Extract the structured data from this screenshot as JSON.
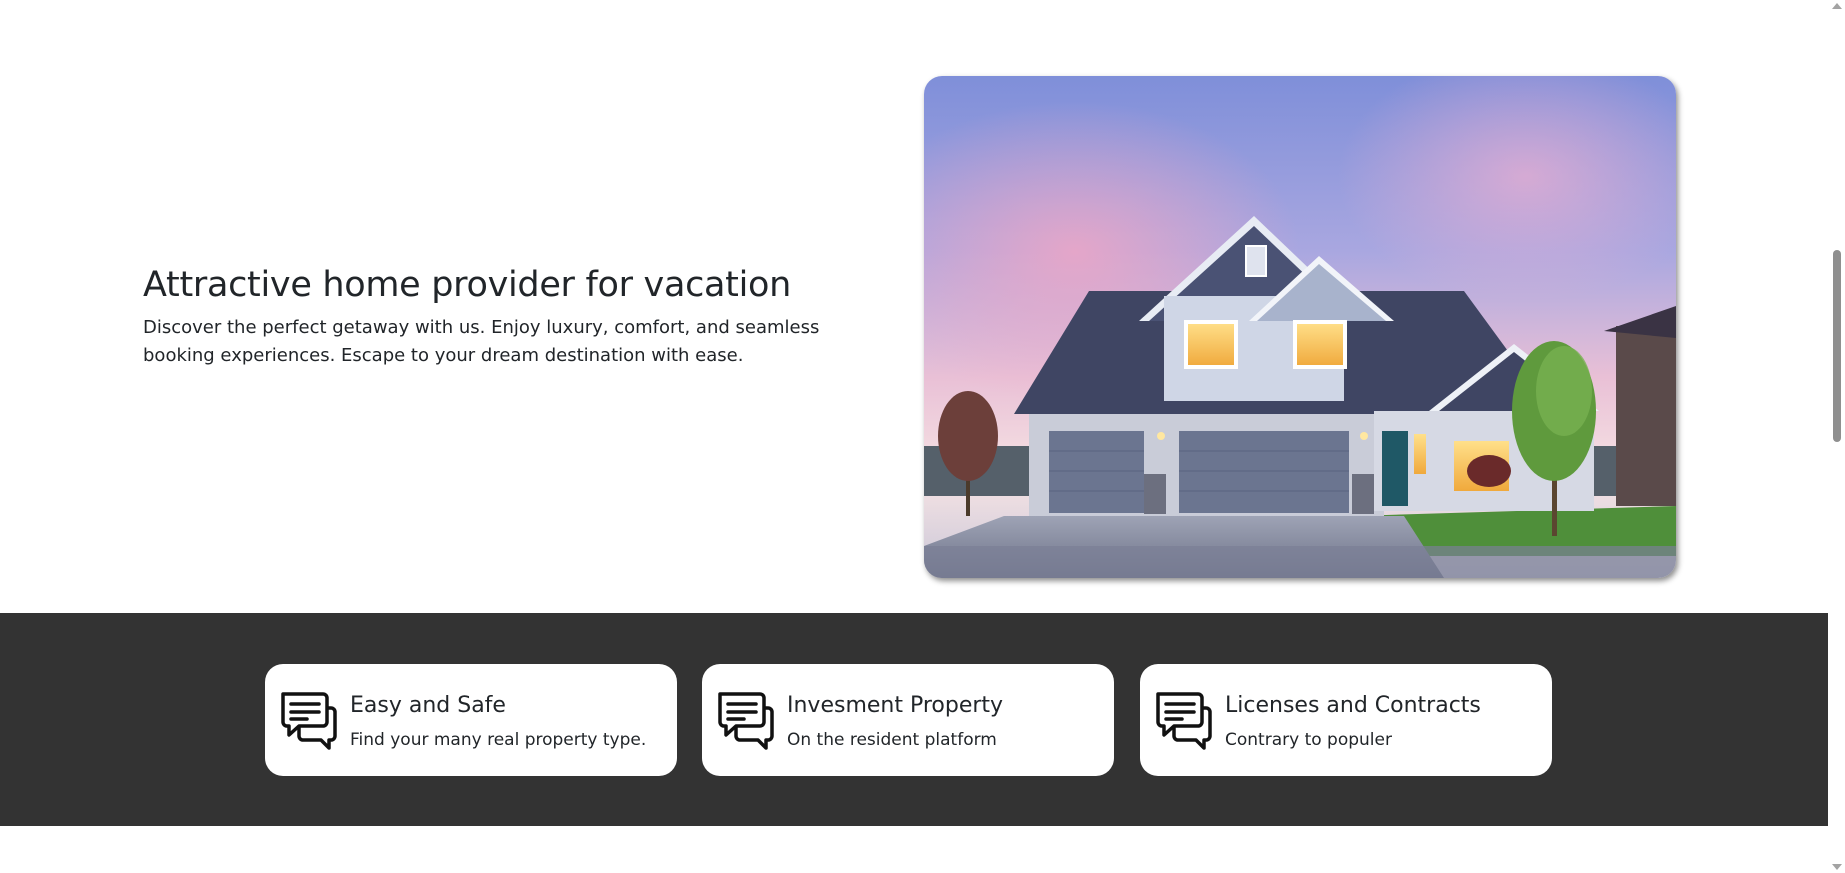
{
  "hero": {
    "title": "Attractive home provider for vacation",
    "description": "Discover the perfect getaway with us. Enjoy luxury, comfort, and seamless booking experiences. Escape to your dream destination with ease."
  },
  "features": {
    "band_color": "#333333",
    "items": [
      {
        "icon": "chat-bubbles-icon",
        "title": "Easy and Safe",
        "subtitle": "Find your many real property type."
      },
      {
        "icon": "chat-bubbles-icon",
        "title": "Invesment Property",
        "subtitle": "On the resident platform"
      },
      {
        "icon": "chat-bubbles-icon",
        "title": "Licenses and Contracts",
        "subtitle": "Contrary to populer"
      }
    ]
  },
  "scrollbar": {
    "up_icon": "scroll-up-arrow-icon",
    "down_icon": "scroll-down-arrow-icon"
  }
}
